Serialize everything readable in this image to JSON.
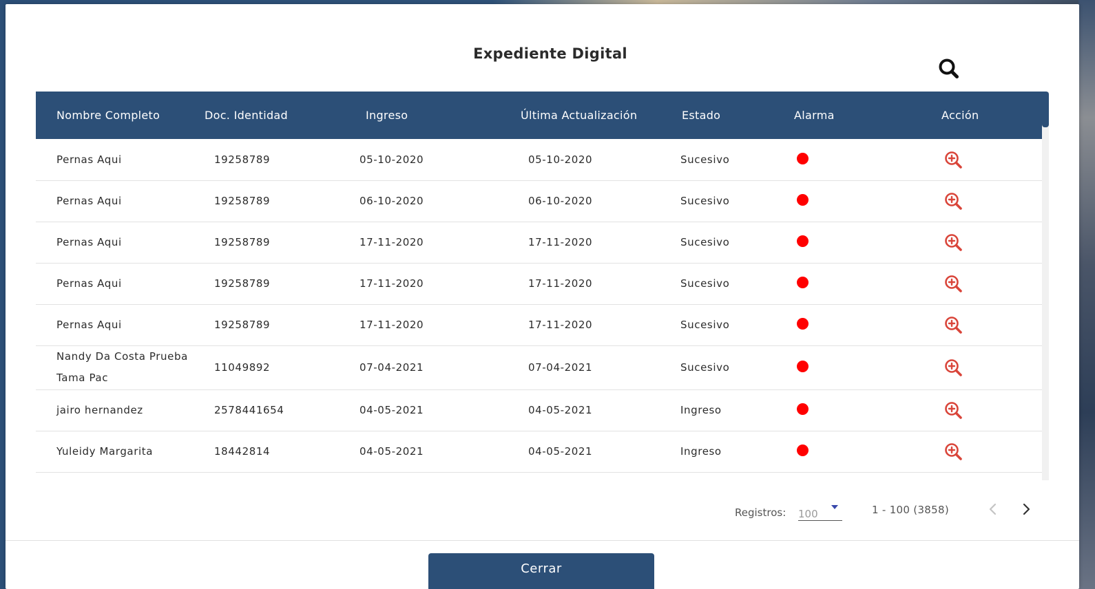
{
  "modal": {
    "title": "Expediente Digital",
    "close_label": "Cerrar"
  },
  "search": {
    "icon": "search-icon"
  },
  "table": {
    "headers": {
      "name": "Nombre Completo",
      "doc": "Doc. Identidad",
      "ingreso": "Ingreso",
      "ultima": "Última Actualización",
      "estado": "Estado",
      "alarma": "Alarma",
      "accion": "Acción"
    },
    "alarm_color": "#ff0000",
    "action_icon": "zoom-in-icon",
    "action_color": "#d9453a",
    "rows": [
      {
        "name": "Pernas Aqui",
        "doc": "19258789",
        "ingreso": "05-10-2020",
        "ultima": "05-10-2020",
        "estado": "Sucesivo"
      },
      {
        "name": "Pernas Aqui",
        "doc": "19258789",
        "ingreso": "06-10-2020",
        "ultima": "06-10-2020",
        "estado": "Sucesivo"
      },
      {
        "name": "Pernas Aqui",
        "doc": "19258789",
        "ingreso": "17-11-2020",
        "ultima": "17-11-2020",
        "estado": "Sucesivo"
      },
      {
        "name": "Pernas Aqui",
        "doc": "19258789",
        "ingreso": "17-11-2020",
        "ultima": "17-11-2020",
        "estado": "Sucesivo"
      },
      {
        "name": "Pernas Aqui",
        "doc": "19258789",
        "ingreso": "17-11-2020",
        "ultima": "17-11-2020",
        "estado": "Sucesivo"
      },
      {
        "name": "Nandy Da Costa Prueba Tama Pac",
        "doc": "11049892",
        "ingreso": "07-04-2021",
        "ultima": "07-04-2021",
        "estado": "Sucesivo"
      },
      {
        "name": "jairo hernandez",
        "doc": "2578441654",
        "ingreso": "04-05-2021",
        "ultima": "04-05-2021",
        "estado": "Ingreso"
      },
      {
        "name": "Yuleidy Margarita",
        "doc": "18442814",
        "ingreso": "04-05-2021",
        "ultima": "04-05-2021",
        "estado": "Ingreso"
      }
    ]
  },
  "pagination": {
    "registros_label": "Registros:",
    "page_size": "100",
    "range": "1 - 100 (3858)",
    "prev_icon": "chevron-left-icon",
    "next_icon": "chevron-right-icon"
  },
  "theme": {
    "primary": "#2c4f77"
  }
}
